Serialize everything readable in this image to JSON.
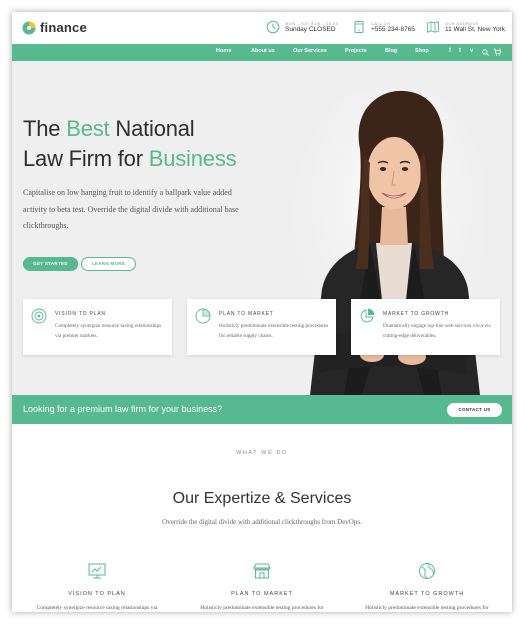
{
  "brand": {
    "name": "finance",
    "accent": "#57b98f"
  },
  "topbar": {
    "hours": {
      "label": "MON – SAT 8.00 – 18.00",
      "value": "Sunday CLOSED",
      "icon": "clock-icon"
    },
    "phone": {
      "label": "CALL US",
      "value": "+555 234-8765",
      "icon": "phone-icon"
    },
    "address": {
      "label": "OUR ADDRESS",
      "value": "11 Wall St, New York",
      "icon": "map-icon"
    }
  },
  "nav": {
    "items": [
      "Home",
      "About us",
      "Our Services",
      "Projects",
      "Blog",
      "Shop"
    ],
    "social": [
      "f",
      "t",
      "v",
      "in"
    ]
  },
  "hero": {
    "title_line1_pre": "The ",
    "title_line1_acc": "Best",
    "title_line1_post": " National",
    "title_line2_pre": "Law Firm for ",
    "title_line2_acc": "Business",
    "subtitle": "Capitalise on low hanging fruit to identify a ballpark value added activity to beta test. Override the digital divide with additional base clickthroughs.",
    "btn_primary": "GET STARTED",
    "btn_secondary": "LEARN MORE"
  },
  "cards": [
    {
      "title": "VISION TO PLAN",
      "text": "Completely synergize resource taxing relationships via premier markets.",
      "icon": "target-icon"
    },
    {
      "title": "PLAN TO MARKET",
      "text": "Holisticly predominate extensible testing procedures for reliable supply chains.",
      "icon": "chart-icon"
    },
    {
      "title": "MARKET TO GROWTH",
      "text": "Dramatically engage top-line web services vis-a-vis cutting-edge deliverables.",
      "icon": "pie-icon"
    }
  ],
  "cta": {
    "text": "Looking for a premium law firm for your business?",
    "button": "CONTACT US"
  },
  "services": {
    "eyebrow": "WHAT WE DO",
    "title": "Our Expertize & Services",
    "subtitle": "Override the digital divide with additional clickthroughs from DevOps.",
    "items": [
      {
        "title": "VISION TO PLAN",
        "text": "Completely synergize resource taxing relationships via",
        "icon": "presentation-icon"
      },
      {
        "title": "PLAN TO MARKET",
        "text": "Holisticly predominate extensible testing procedures for",
        "icon": "store-icon"
      },
      {
        "title": "MARKET TO GROWTH",
        "text": "Holisticly predominate extensible testing procedures for",
        "icon": "globe-icon"
      }
    ]
  }
}
